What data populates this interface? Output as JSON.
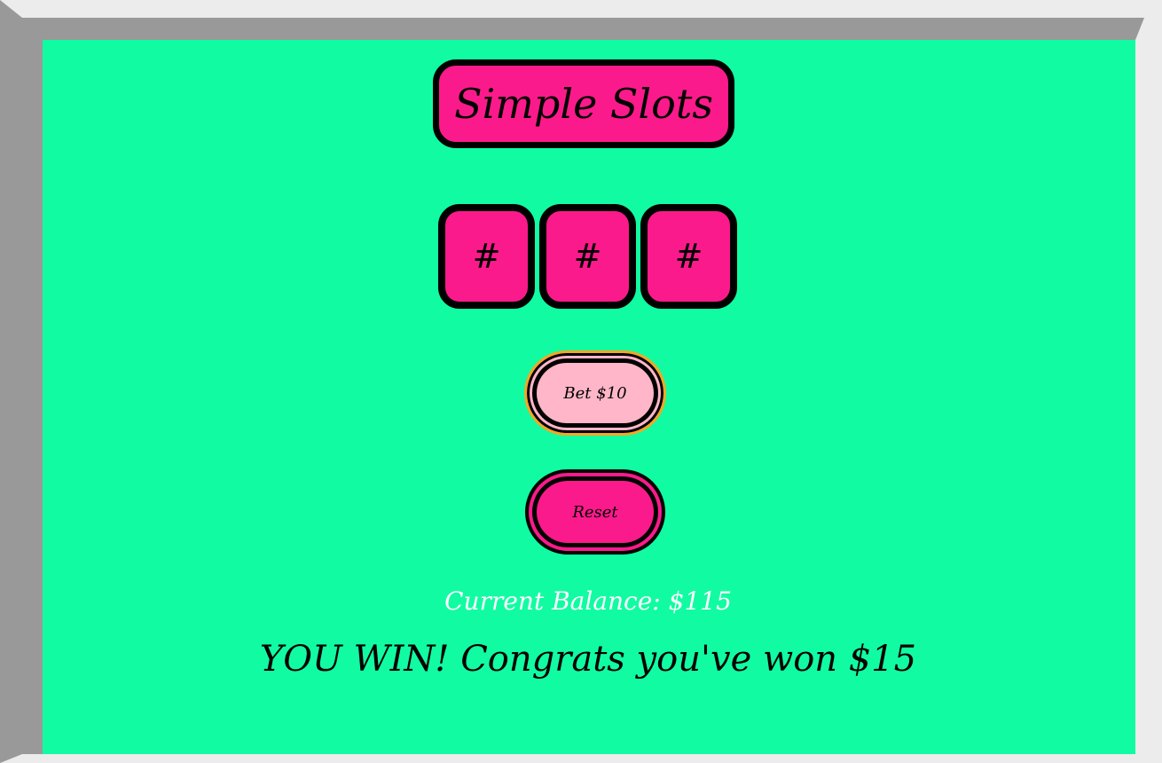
{
  "app": {
    "title": "Simple Slots"
  },
  "reels": [
    {
      "symbol": "#"
    },
    {
      "symbol": "#"
    },
    {
      "symbol": "#"
    }
  ],
  "controls": {
    "bet_label": "Bet $10",
    "reset_label": "Reset"
  },
  "status": {
    "balance_text": "Current Balance: $115",
    "message": "YOU WIN! Congrats you've won $15"
  },
  "colors": {
    "background": "#11fca2",
    "accent_pink": "#fb1a8b",
    "bet_button_fill": "#ffb6c8",
    "bet_button_outline": "#f5a623",
    "balance_text": "#ffffff"
  }
}
